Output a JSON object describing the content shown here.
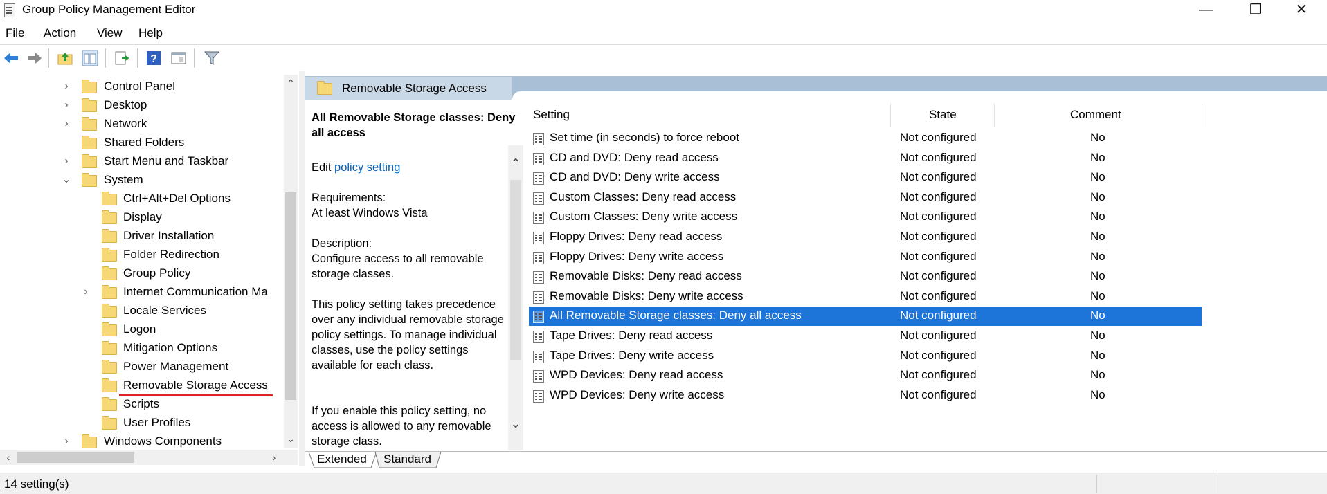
{
  "window": {
    "title": "Group Policy Management Editor",
    "controls": [
      "—",
      "❐",
      "✕"
    ]
  },
  "menu": [
    "File",
    "Action",
    "View",
    "Help"
  ],
  "toolbar": {
    "icons": [
      "back-icon",
      "forward-icon",
      "up-folder-icon",
      "show-hide-tree-icon",
      "export-list-icon",
      "help-icon",
      "properties-icon",
      "filter-icon"
    ]
  },
  "tree": {
    "items": [
      {
        "label": "Control Panel",
        "expander": "›"
      },
      {
        "label": "Desktop",
        "expander": "›"
      },
      {
        "label": "Network",
        "expander": "›"
      },
      {
        "label": "Shared Folders",
        "expander": ""
      },
      {
        "label": "Start Menu and Taskbar",
        "expander": "›"
      },
      {
        "label": "System",
        "expander": "⌄"
      },
      {
        "label": "Ctrl+Alt+Del Options",
        "expander": ""
      },
      {
        "label": "Display",
        "expander": ""
      },
      {
        "label": "Driver Installation",
        "expander": ""
      },
      {
        "label": "Folder Redirection",
        "expander": ""
      },
      {
        "label": "Group Policy",
        "expander": ""
      },
      {
        "label": "Internet Communication Ma",
        "expander": "›"
      },
      {
        "label": "Locale Services",
        "expander": ""
      },
      {
        "label": "Logon",
        "expander": ""
      },
      {
        "label": "Mitigation Options",
        "expander": ""
      },
      {
        "label": "Power Management",
        "expander": ""
      },
      {
        "label": "Removable Storage Access",
        "expander": ""
      },
      {
        "label": "Scripts",
        "expander": ""
      },
      {
        "label": "User Profiles",
        "expander": ""
      },
      {
        "label": "Windows Components",
        "expander": "›"
      }
    ],
    "selected": "Removable Storage Access"
  },
  "header": {
    "title": "Removable Storage Access"
  },
  "description": {
    "title": "All Removable Storage classes: Deny all access",
    "edit_prefix": "Edit ",
    "edit_link": "policy setting",
    "requirements_label": "Requirements:",
    "requirements_value": "At least Windows Vista",
    "description_label": "Description:",
    "description_value": "Configure access to all removable storage classes.",
    "para1": "This policy setting takes precedence over any individual removable storage policy settings. To manage individual classes, use the policy settings available for each class.",
    "para2": "If you enable this policy setting, no access is allowed to any removable storage class."
  },
  "list": {
    "columns": {
      "setting": "Setting",
      "state": "State",
      "comment": "Comment"
    },
    "rows": [
      {
        "setting": "Set time (in seconds) to force reboot",
        "state": "Not configured",
        "comment": "No"
      },
      {
        "setting": "CD and DVD: Deny read access",
        "state": "Not configured",
        "comment": "No"
      },
      {
        "setting": "CD and DVD: Deny write access",
        "state": "Not configured",
        "comment": "No"
      },
      {
        "setting": "Custom Classes: Deny read access",
        "state": "Not configured",
        "comment": "No"
      },
      {
        "setting": "Custom Classes: Deny write access",
        "state": "Not configured",
        "comment": "No"
      },
      {
        "setting": "Floppy Drives: Deny read access",
        "state": "Not configured",
        "comment": "No"
      },
      {
        "setting": "Floppy Drives: Deny write access",
        "state": "Not configured",
        "comment": "No"
      },
      {
        "setting": "Removable Disks: Deny read access",
        "state": "Not configured",
        "comment": "No"
      },
      {
        "setting": "Removable Disks: Deny write access",
        "state": "Not configured",
        "comment": "No"
      },
      {
        "setting": "All Removable Storage classes: Deny all access",
        "state": "Not configured",
        "comment": "No"
      },
      {
        "setting": "Tape Drives: Deny read access",
        "state": "Not configured",
        "comment": "No"
      },
      {
        "setting": "Tape Drives: Deny write access",
        "state": "Not configured",
        "comment": "No"
      },
      {
        "setting": "WPD Devices: Deny read access",
        "state": "Not configured",
        "comment": "No"
      },
      {
        "setting": "WPD Devices: Deny write access",
        "state": "Not configured",
        "comment": "No"
      }
    ],
    "selected_index": 9
  },
  "tabs": [
    "Extended",
    "Standard"
  ],
  "status": {
    "text": "14 setting(s)"
  },
  "colors": {
    "selection": "#1e75d9",
    "header_band": "#a9bfd6",
    "link": "#0563c1",
    "annotation_underline": "#e0242a"
  }
}
